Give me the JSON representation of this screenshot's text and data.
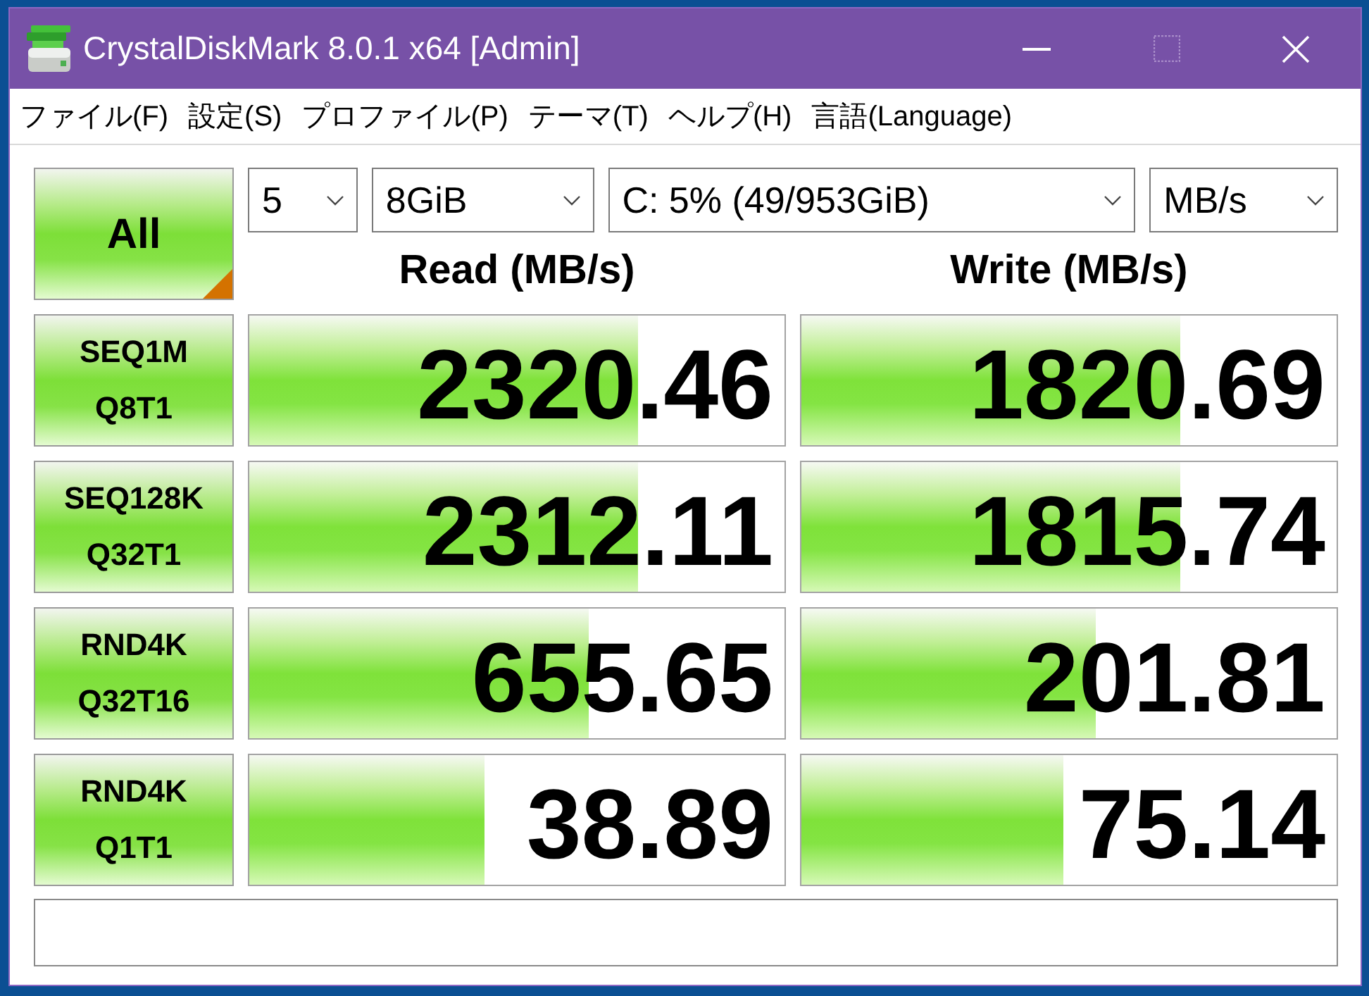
{
  "window": {
    "title": "CrystalDiskMark 8.0.1 x64 [Admin]",
    "controls": [
      {
        "kind": "minimize",
        "disabled": false
      },
      {
        "kind": "maximize",
        "disabled": true
      },
      {
        "kind": "close",
        "disabled": false
      }
    ]
  },
  "menu": [
    "ファイル(F)",
    "設定(S)",
    "プロファイル(P)",
    "テーマ(T)",
    "ヘルプ(H)",
    "言語(Language)"
  ],
  "all_button": {
    "label": "All"
  },
  "selectors": [
    {
      "value": "5"
    },
    {
      "value": "8GiB"
    },
    {
      "value": "C: 5% (49/953GiB)"
    },
    {
      "value": "MB/s"
    }
  ],
  "columns": [
    "Read (MB/s)",
    "Write (MB/s)"
  ],
  "tests": [
    {
      "name": "SEQ1M",
      "params": "Q8T1",
      "read": {
        "value": "2320.46",
        "level": 0.725
      },
      "write": {
        "value": "1820.69",
        "level": 0.707
      }
    },
    {
      "name": "SEQ128K",
      "params": "Q32T1",
      "read": {
        "value": "2312.11",
        "level": 0.725
      },
      "write": {
        "value": "1815.74",
        "level": 0.707
      }
    },
    {
      "name": "RND4K",
      "params": "Q32T16",
      "read": {
        "value": "655.65",
        "level": 0.634
      },
      "write": {
        "value": "201.81",
        "level": 0.55
      }
    },
    {
      "name": "RND4K",
      "params": "Q1T1",
      "read": {
        "value": "38.89",
        "level": 0.44
      },
      "write": {
        "value": "75.14",
        "level": 0.49
      }
    }
  ]
}
